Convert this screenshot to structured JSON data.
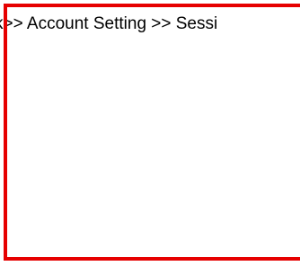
{
  "breadcrumb": {
    "text": "k>> Account Setting >> Sessi"
  },
  "colors": {
    "highlight_border": "#e60000",
    "text": "#000000",
    "background": "#ffffff"
  }
}
